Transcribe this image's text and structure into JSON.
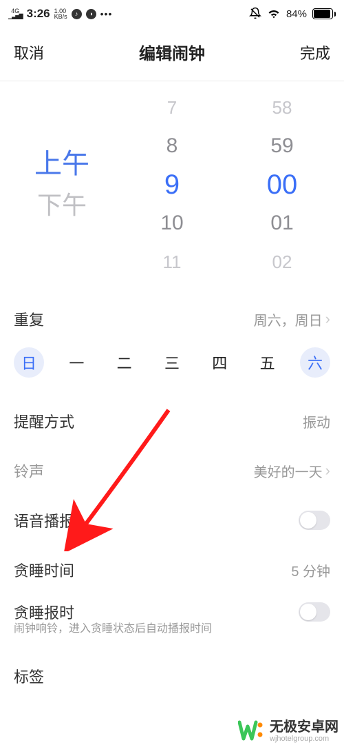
{
  "status": {
    "net": "4G",
    "time": "3:26",
    "kbs_top": "1.00",
    "kbs_bot": "KB/s",
    "battery_text": "84%"
  },
  "header": {
    "cancel": "取消",
    "title": "编辑闹钟",
    "done": "完成"
  },
  "picker": {
    "ampm_am": "上午",
    "ampm_pm": "下午",
    "hours": {
      "m2": "7",
      "m1": "8",
      "sel": "9",
      "p1": "10",
      "p2": "11"
    },
    "minutes": {
      "m2": "58",
      "m1": "59",
      "sel": "00",
      "p1": "01",
      "p2": "02"
    }
  },
  "repeat": {
    "label": "重复",
    "value": "周六，周日",
    "days": [
      "日",
      "一",
      "二",
      "三",
      "四",
      "五",
      "六"
    ],
    "selected": [
      0,
      6
    ]
  },
  "remind": {
    "label": "提醒方式",
    "value": "振动"
  },
  "ringtone": {
    "label": "铃声",
    "value": "美好的一天"
  },
  "voice": {
    "label": "语音播报"
  },
  "snooze_time": {
    "label": "贪睡时间",
    "value": "5 分钟"
  },
  "snooze_announce": {
    "label": "贪睡报时",
    "desc": "闹钟响铃，进入贪睡状态后自动播报时间"
  },
  "tag": {
    "label": "标签"
  },
  "watermark": {
    "main": "无极安卓网",
    "sub": "wjhotelgroup.com"
  }
}
